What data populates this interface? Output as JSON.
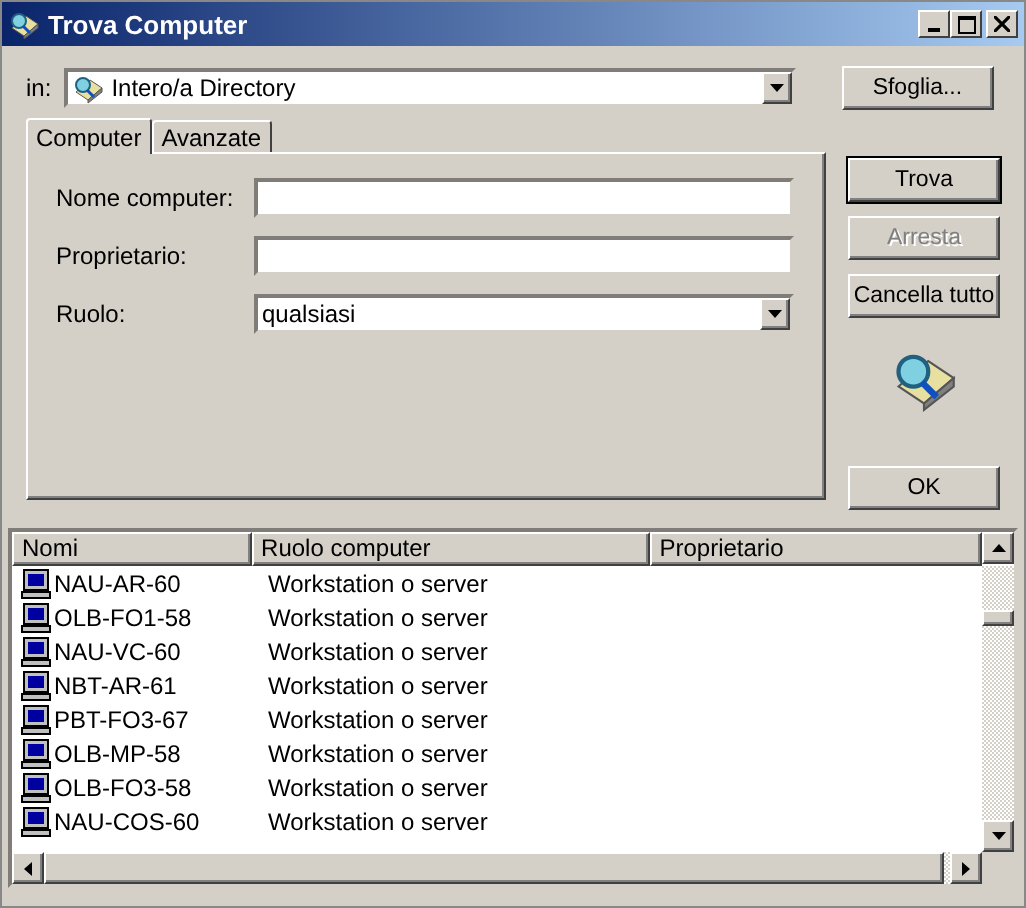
{
  "window": {
    "title": "Trova Computer"
  },
  "scope": {
    "label": "in:",
    "value": "Intero/a Directory",
    "browse": "Sfoglia..."
  },
  "tabs": [
    {
      "label": "Computer",
      "selected": true
    },
    {
      "label": "Avanzate",
      "selected": false
    }
  ],
  "fields": [
    {
      "kind": "text",
      "label": "Nome computer:"
    },
    {
      "kind": "text",
      "label": "Proprietario:"
    },
    {
      "kind": "select",
      "label": "Ruolo:",
      "value": "qualsiasi"
    }
  ],
  "buttons": [
    {
      "label": "Trova",
      "disabled": false,
      "default": true
    },
    {
      "label": "Arresta",
      "disabled": true,
      "default": false
    },
    {
      "label": "Cancella tutto",
      "disabled": false,
      "default": false
    }
  ],
  "ok": "OK",
  "table": {
    "columns": [
      "Nomi",
      "Ruolo computer",
      "Proprietario"
    ],
    "rows": [
      {
        "name": "NAU-AR-60",
        "role": "Workstation o server"
      },
      {
        "name": "OLB-FO1-58",
        "role": "Workstation o server"
      },
      {
        "name": "NAU-VC-60",
        "role": "Workstation o server"
      },
      {
        "name": "NBT-AR-61",
        "role": "Workstation o server"
      },
      {
        "name": "PBT-FO3-67",
        "role": "Workstation o server"
      },
      {
        "name": "OLB-MP-58",
        "role": "Workstation o server"
      },
      {
        "name": "OLB-FO3-58",
        "role": "Workstation o server"
      },
      {
        "name": "NAU-COS-60",
        "role": "Workstation o server"
      }
    ]
  }
}
